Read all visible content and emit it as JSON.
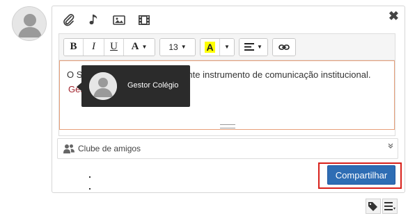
{
  "composer": {
    "attachments": [
      "paperclip-icon",
      "music-note-icon",
      "image-icon",
      "video-icon"
    ],
    "close_label": "✖"
  },
  "toolbar": {
    "bold": "B",
    "italic": "I",
    "underline": "U",
    "font_color": "A",
    "font_size": "13",
    "highlight": "A",
    "align_icon": "align-left-icon",
    "link_icon": "link-icon"
  },
  "editor": {
    "text": "O Sagres Social é um importante instrumento de comunicação institucional.",
    "mention": "Gestor Colégio"
  },
  "tooltip": {
    "name": "Gestor Colégio"
  },
  "audience": {
    "label": "Clube de amigos",
    "chevron": "»"
  },
  "share_button": "Compartilhar",
  "colors": {
    "accent": "#2e6db4",
    "mention": "#a3262f",
    "highlight_box": "#d8201a",
    "editor_border": "#e8a07a"
  },
  "footer_icons": [
    "tags-icon",
    "list-icon"
  ]
}
